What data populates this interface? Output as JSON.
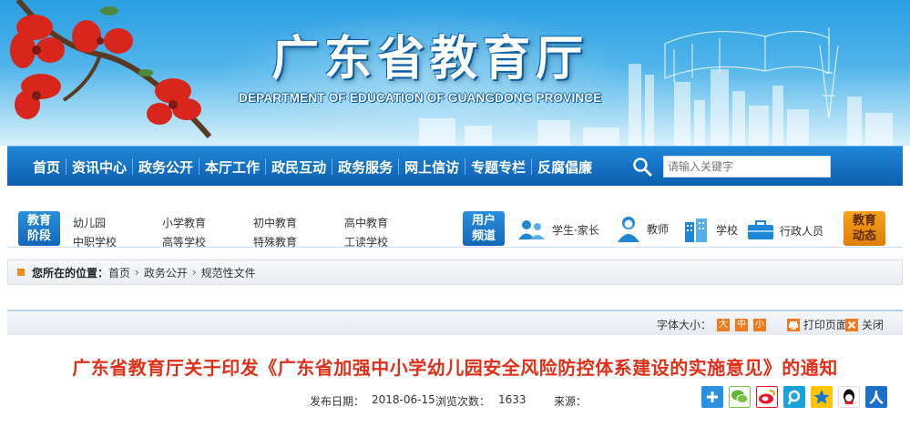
{
  "banner": {
    "title": "广东省教育厅",
    "subtitle": "DEPARTMENT OF EDUCATION OF GUANGDONG PROVINCE"
  },
  "nav": {
    "items": [
      "首页",
      "资讯中心",
      "政务公开",
      "本厅工作",
      "政民互动",
      "政务服务",
      "网上信访",
      "专题专栏",
      "反腐倡廉"
    ],
    "search_placeholder": "请输入关键字"
  },
  "channels": {
    "stage_badge": [
      "教育",
      "阶段"
    ],
    "stages": [
      "幼儿园",
      "小学教育",
      "初中教育",
      "高中教育",
      "中职学校",
      "高等学校",
      "特殊教育",
      "工读学校"
    ],
    "user_badge": [
      "用户",
      "频道"
    ],
    "users": [
      "学生·家长",
      "教师",
      "学校",
      "行政人员"
    ],
    "news_badge": [
      "教育",
      "动态"
    ]
  },
  "breadcrumb": {
    "label": "您所在的位置：",
    "items": [
      "首页",
      "政务公开",
      "规范性文件"
    ],
    "separator": "›"
  },
  "tools": {
    "font_size_label": "字体大小：",
    "sizes": [
      "大",
      "中",
      "小"
    ],
    "print_label": "打印页面",
    "close_label": "关闭"
  },
  "article": {
    "title": "广东省教育厅关于印发《广东省加强中小学幼儿园安全风险防控体系建设的实施意见》的通知",
    "date_label": "发布日期：",
    "date": "2018-06-15",
    "views_label": "浏览次数：",
    "views": "1633",
    "source_label": "来源："
  },
  "colors": {
    "nav_blue": "#1570c3",
    "title_red": "#e03018",
    "accent_orange": "#f07a1e"
  },
  "share_icons": [
    "plus-icon",
    "wechat-icon",
    "weibo-icon",
    "tencent-weibo-icon",
    "qzone-icon",
    "qq-icon",
    "renren-icon"
  ]
}
